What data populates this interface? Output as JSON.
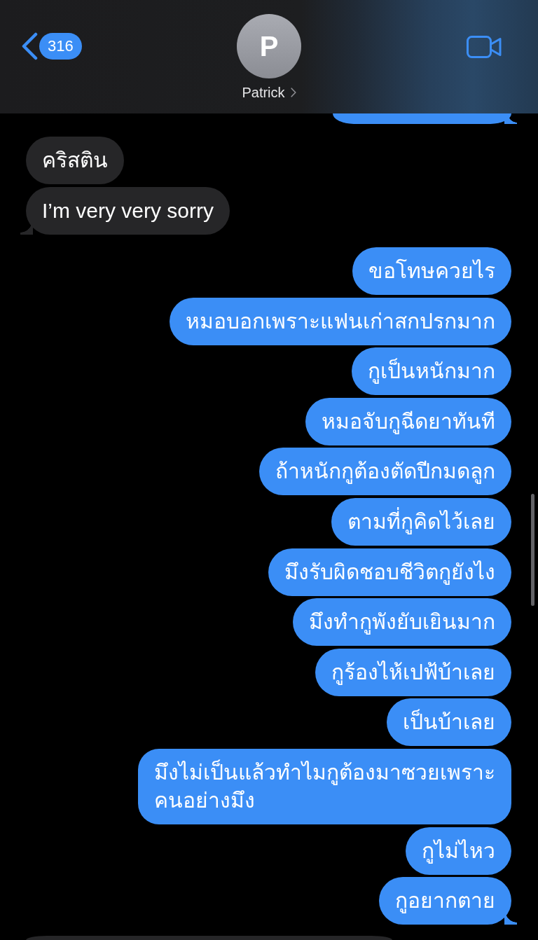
{
  "header": {
    "back_count": "316",
    "avatar_initial": "P",
    "contact_name": "Patrick"
  },
  "messages": [
    {
      "kind": "sent",
      "cut_off": true,
      "tail": true
    },
    {
      "kind": "received",
      "text": "คริสติน",
      "cut_off": false,
      "tail": false
    },
    {
      "kind": "received",
      "text": "I’m very very sorry",
      "cut_off": false,
      "tail": true
    },
    {
      "kind": "sent",
      "text": "ขอโทษควยไร",
      "cut_off": false,
      "tail": false
    },
    {
      "kind": "sent",
      "text": "หมอบอกเพราะแฟนเก่าสกปรกมาก",
      "cut_off": false,
      "tail": false
    },
    {
      "kind": "sent",
      "text": "กูเป็นหนักมาก",
      "cut_off": false,
      "tail": false
    },
    {
      "kind": "sent",
      "text": "หมอจับกูฉีดยาทันที",
      "cut_off": false,
      "tail": false
    },
    {
      "kind": "sent",
      "text": "ถ้าหนักกูต้องตัดปีกมดลูก",
      "cut_off": false,
      "tail": false
    },
    {
      "kind": "sent",
      "text": "ตามที่กูคิดไว้เลย",
      "cut_off": false,
      "tail": false
    },
    {
      "kind": "sent",
      "text": "มึงรับผิดชอบชีวิตกูยังไง",
      "cut_off": false,
      "tail": false
    },
    {
      "kind": "sent",
      "text": "มึงทำกูพังยับเยินมาก",
      "cut_off": false,
      "tail": false
    },
    {
      "kind": "sent",
      "text": "กูร้องไห้เปฟ้บ้าเลย",
      "cut_off": false,
      "tail": false
    },
    {
      "kind": "sent",
      "text": "เป็นบ้าเลย",
      "cut_off": false,
      "tail": false
    },
    {
      "kind": "sent",
      "text": "มึงไม่เป็นแล้วทำไมกูต้องมาซวยเพราะ\nคนอย่างมึง",
      "cut_off": false,
      "tail": false
    },
    {
      "kind": "sent",
      "text": "กูไม่ไหว",
      "cut_off": false,
      "tail": false
    },
    {
      "kind": "sent",
      "text": "กูอยากตาย",
      "cut_off": false,
      "tail": true
    },
    {
      "kind": "received",
      "cut_off": true,
      "tail": false
    }
  ]
}
